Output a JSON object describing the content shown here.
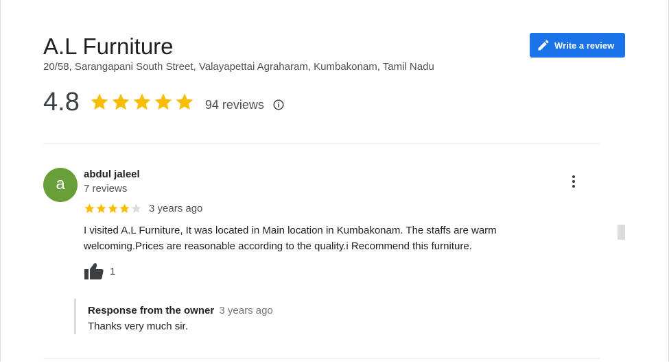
{
  "business": {
    "name": "A.L Furniture",
    "address": "20/58, Sarangapani South Street, Valayapettai Agraharam, Kumbakonam, Tamil Nadu",
    "rating": "4.8",
    "rating_value": 4.8,
    "review_count_label": "94 reviews"
  },
  "actions": {
    "write_review_label": "Write a review"
  },
  "review": {
    "avatar_letter": "a",
    "avatar_color": "#689f38",
    "author": "abdul jaleel",
    "author_reviews": "7 reviews",
    "stars": 4,
    "max_stars": 5,
    "date": "3 years ago",
    "text": "I visited A.L Furniture, It was located in Main location in Kumbakonam. The staffs are warm welcoming.Prices are reasonable according to the quality.i Recommend this furniture.",
    "likes": "1",
    "owner_response": {
      "title": "Response from the owner",
      "date": "3 years ago",
      "text": "Thanks very much sir."
    }
  },
  "colors": {
    "accent": "#1a73e8",
    "star_filled": "#fbbc04",
    "star_empty": "#dadce0"
  },
  "icons": {
    "write": "pencil-icon",
    "info": "info-icon",
    "more": "more-vert-icon",
    "like": "thumb-up-icon"
  }
}
